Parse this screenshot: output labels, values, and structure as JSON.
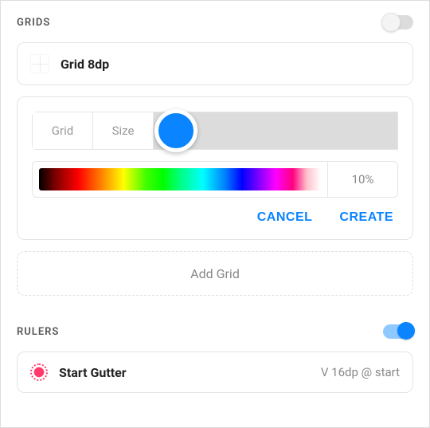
{
  "grids": {
    "title": "GRIDS",
    "toggle_on": false,
    "item": {
      "name": "Grid 8dp"
    },
    "editor": {
      "tabs": {
        "grid": "Grid",
        "size": "Size"
      },
      "color": "#0a84ff",
      "opacity": "10%",
      "cancel": "CANCEL",
      "create": "CREATE"
    },
    "add_label": "Add Grid"
  },
  "rulers": {
    "title": "RULERS",
    "toggle_on": true,
    "item": {
      "name": "Start Gutter",
      "meta": "V 16dp @ start"
    }
  }
}
